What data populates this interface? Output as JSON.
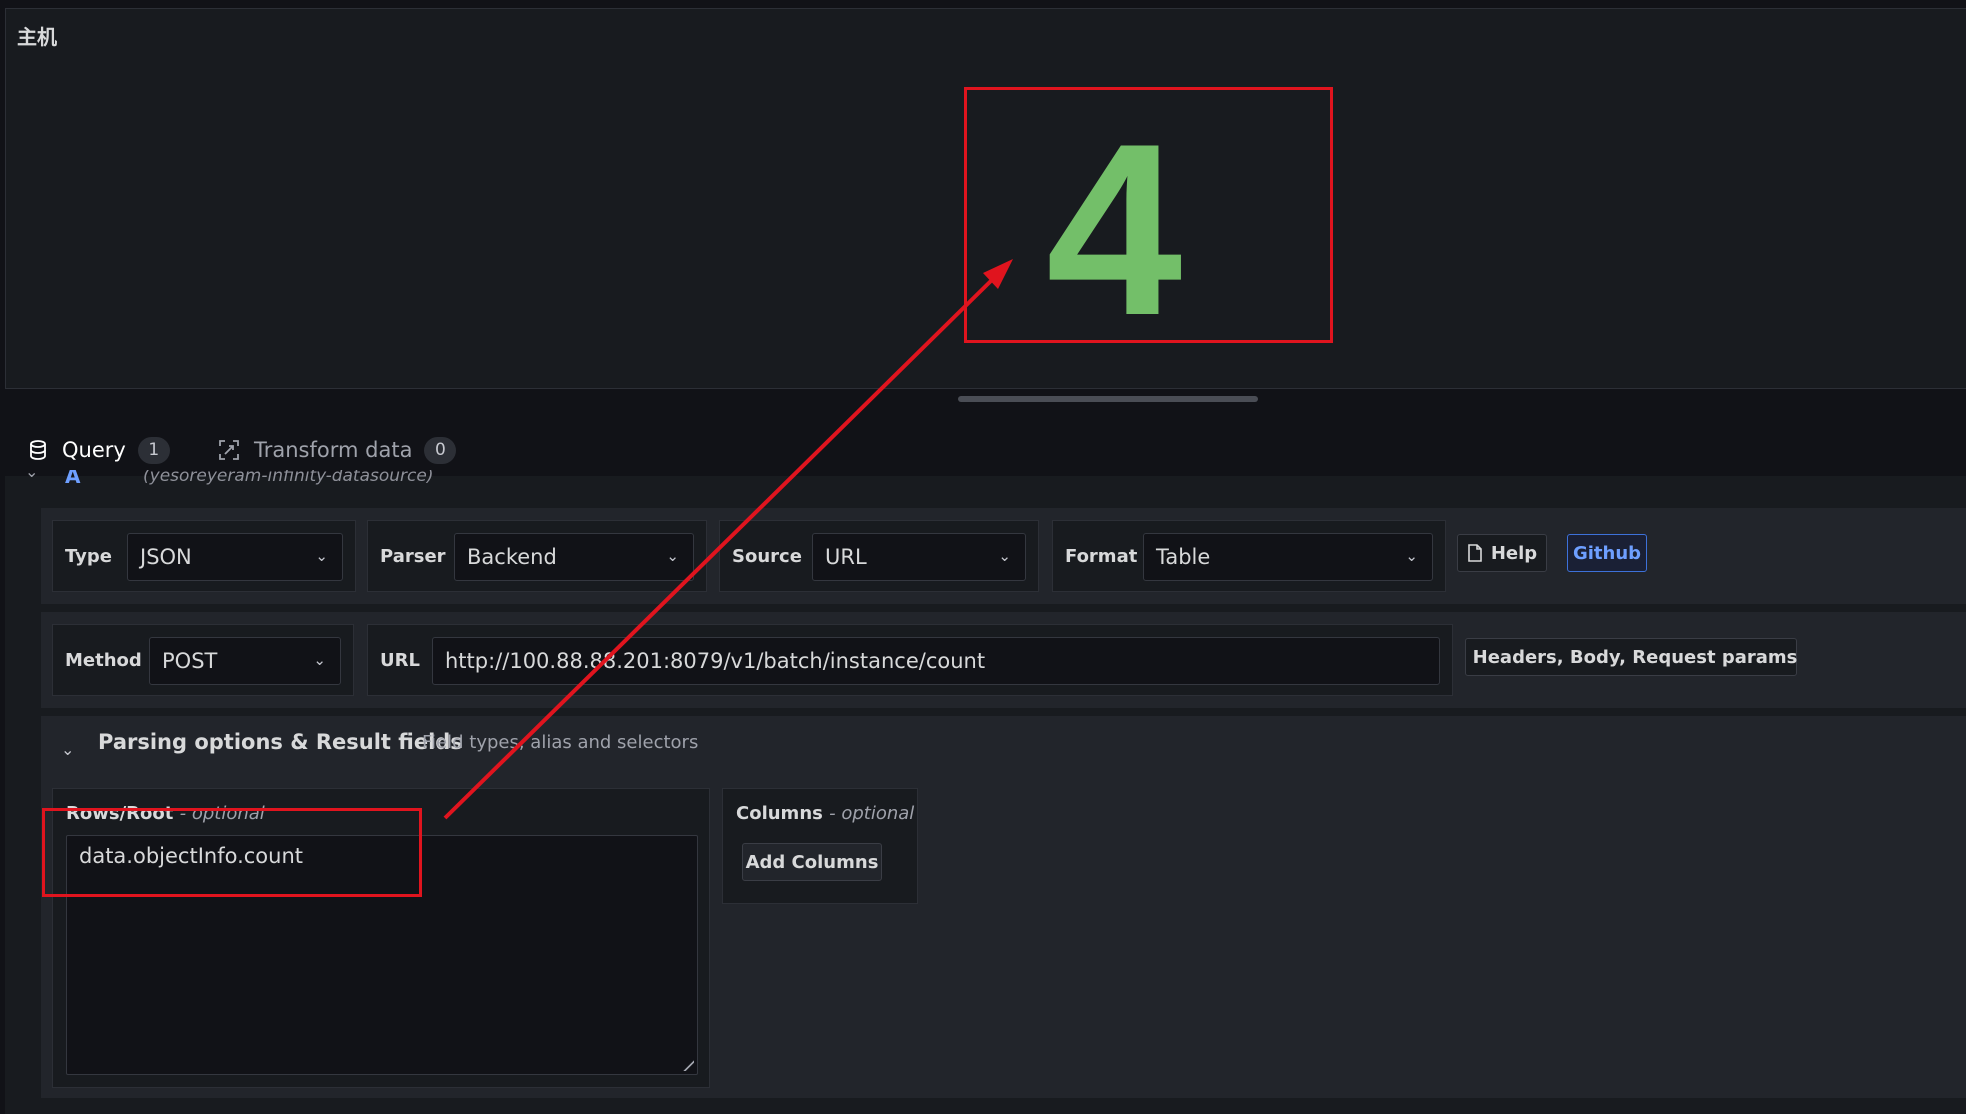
{
  "panel": {
    "title": "主机",
    "stat_value": "4",
    "stat_color": "#73bf69"
  },
  "tabs": [
    {
      "label": "Query",
      "count": "1",
      "icon": "database-icon",
      "active": true
    },
    {
      "label": "Transform data",
      "count": "0",
      "icon": "transform-icon",
      "active": false
    }
  ],
  "query_row": {
    "ref_id": "A",
    "datasource": "(yesoreyeram-infinity-datasource)"
  },
  "config": {
    "type": {
      "label": "Type",
      "value": "JSON"
    },
    "parser": {
      "label": "Parser",
      "value": "Backend"
    },
    "source": {
      "label": "Source",
      "value": "URL"
    },
    "format": {
      "label": "Format",
      "value": "Table"
    },
    "help_label": "Help",
    "github_label": "Github",
    "method": {
      "label": "Method",
      "value": "POST"
    },
    "url": {
      "label": "URL",
      "value": "http://100.88.88.201:8079/v1/batch/instance/count"
    },
    "headers_label": "Headers, Body, Request params"
  },
  "parsing": {
    "title": "Parsing options & Result fields",
    "subtitle": "Field types, alias and selectors",
    "rows_label": "Rows/Root",
    "rows_optional": "- optional",
    "rows_value": "data.objectInfo.count",
    "columns_label": "Columns",
    "columns_optional": "- optional",
    "add_columns_label": "Add Columns"
  },
  "colors": {
    "accent_tab": "#f0723e",
    "annotation_red": "#e0141e",
    "link_blue": "#6e9fff"
  }
}
